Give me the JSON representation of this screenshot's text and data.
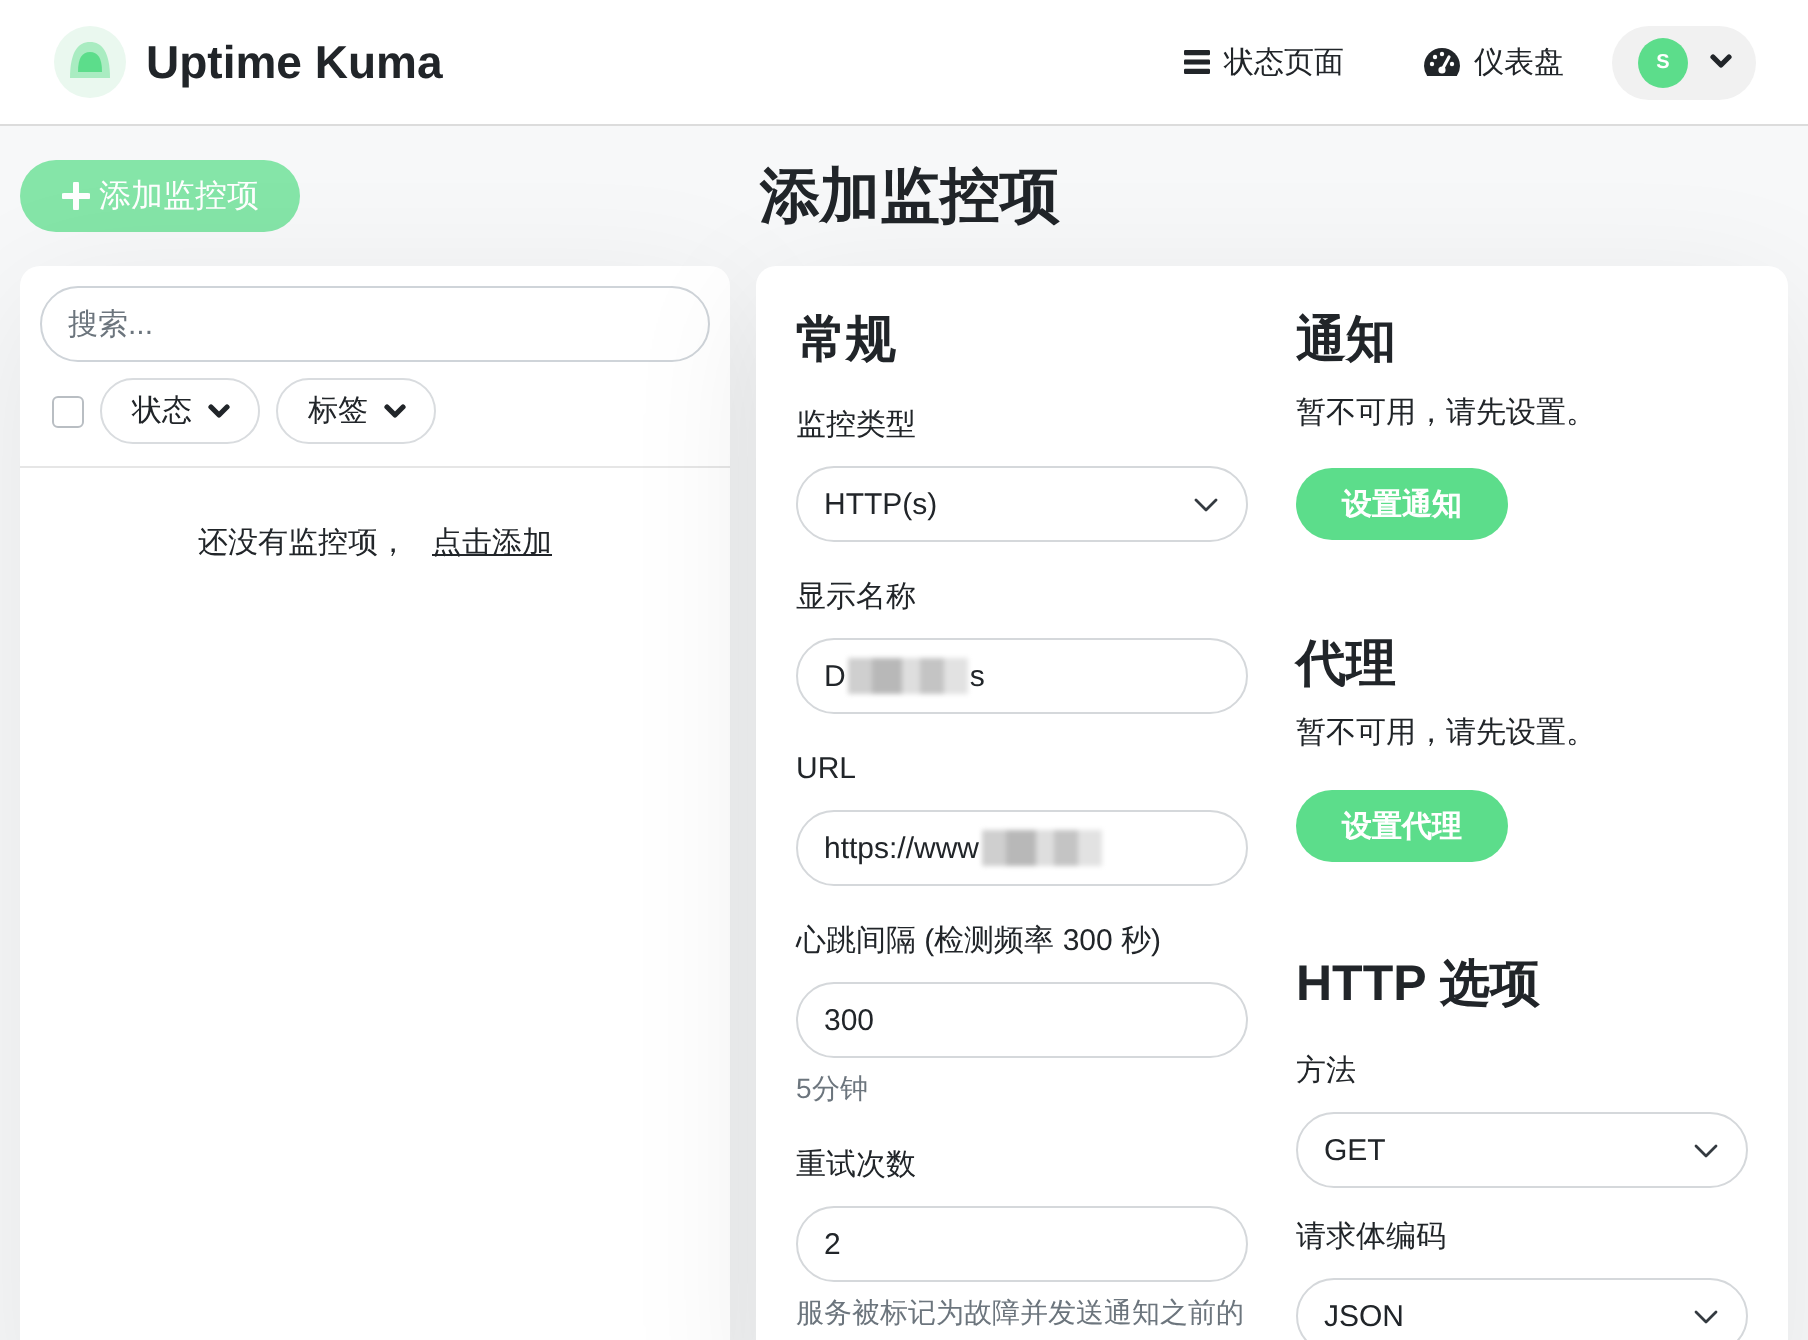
{
  "header": {
    "app_name": "Uptime Kuma",
    "nav": [
      {
        "kind": "status",
        "label": "状态页面"
      },
      {
        "kind": "dashboard",
        "label": "仪表盘"
      }
    ],
    "profile": {
      "initial": "S"
    }
  },
  "sidebar": {
    "add_button": "添加监控项",
    "search": {
      "placeholder": "搜索..."
    },
    "select_all": {
      "checked": false
    },
    "filters": [
      {
        "label": "状态"
      },
      {
        "label": "标签"
      }
    ],
    "empty_message": {
      "text": "还没有监控项，",
      "link": "点击添加"
    }
  },
  "page_title": "添加监控项",
  "general": {
    "heading": "常规",
    "fields": [
      {
        "kind": "select",
        "label": "监控类型",
        "value": "HTTP(s)"
      },
      {
        "kind": "input",
        "label": "显示名称",
        "value_parts": [
          {
            "kind": "text",
            "text": "D"
          },
          {
            "kind": "redacted"
          },
          {
            "kind": "text",
            "text": "s"
          }
        ]
      },
      {
        "kind": "input",
        "label": "URL",
        "value_parts": [
          {
            "kind": "text",
            "text": "https://www"
          },
          {
            "kind": "redacted"
          }
        ]
      },
      {
        "kind": "input",
        "label": "心跳间隔 (检测频率 300 秒)",
        "value": "300",
        "hint": "5分钟"
      },
      {
        "kind": "input",
        "label": "重试次数",
        "value": "2",
        "hint": "服务被标记为故障并发送通知之前的"
      }
    ]
  },
  "notifications": {
    "heading": "通知",
    "message": "暂不可用，请先设置。",
    "button": "设置通知"
  },
  "proxy": {
    "heading": "代理",
    "message": "暂不可用，请先设置。",
    "button": "设置代理"
  },
  "http_options": {
    "heading": "HTTP 选项",
    "fields": [
      {
        "kind": "select",
        "label": "方法",
        "value": "GET"
      },
      {
        "kind": "select",
        "label": "请求体编码",
        "value": "JSON"
      }
    ]
  }
}
